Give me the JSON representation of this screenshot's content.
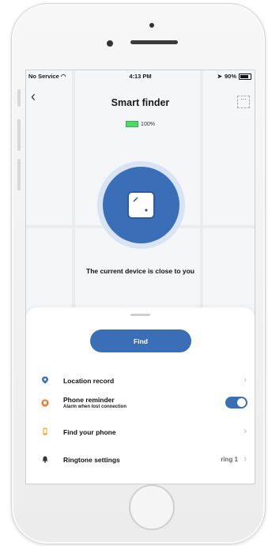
{
  "status_bar": {
    "carrier": "No Service",
    "time": "4:13 PM",
    "battery": "90%"
  },
  "nav": {
    "title": "Smart finder"
  },
  "device": {
    "battery_percent": "100%"
  },
  "proximity_message": "The current device is close to you",
  "actions": {
    "find_label": "Find"
  },
  "menu": [
    {
      "label": "Location record",
      "icon": "location-pin-icon",
      "icon_color": "#3a6fb8"
    },
    {
      "label": "Phone reminder",
      "sub": "Alarm when lost connection",
      "icon": "bell-alarm-icon",
      "icon_color": "#e8803a",
      "toggle_on": true
    },
    {
      "label": "Find your phone",
      "icon": "phone-search-icon",
      "icon_color": "#f2a12a"
    },
    {
      "label": "Ringtone settings",
      "value": "ring 1",
      "icon": "bell-icon",
      "icon_color": "#333333"
    }
  ],
  "colors": {
    "accent": "#3a6fb8",
    "battery_green": "#4cd964",
    "halo": "#d8e4f4"
  }
}
